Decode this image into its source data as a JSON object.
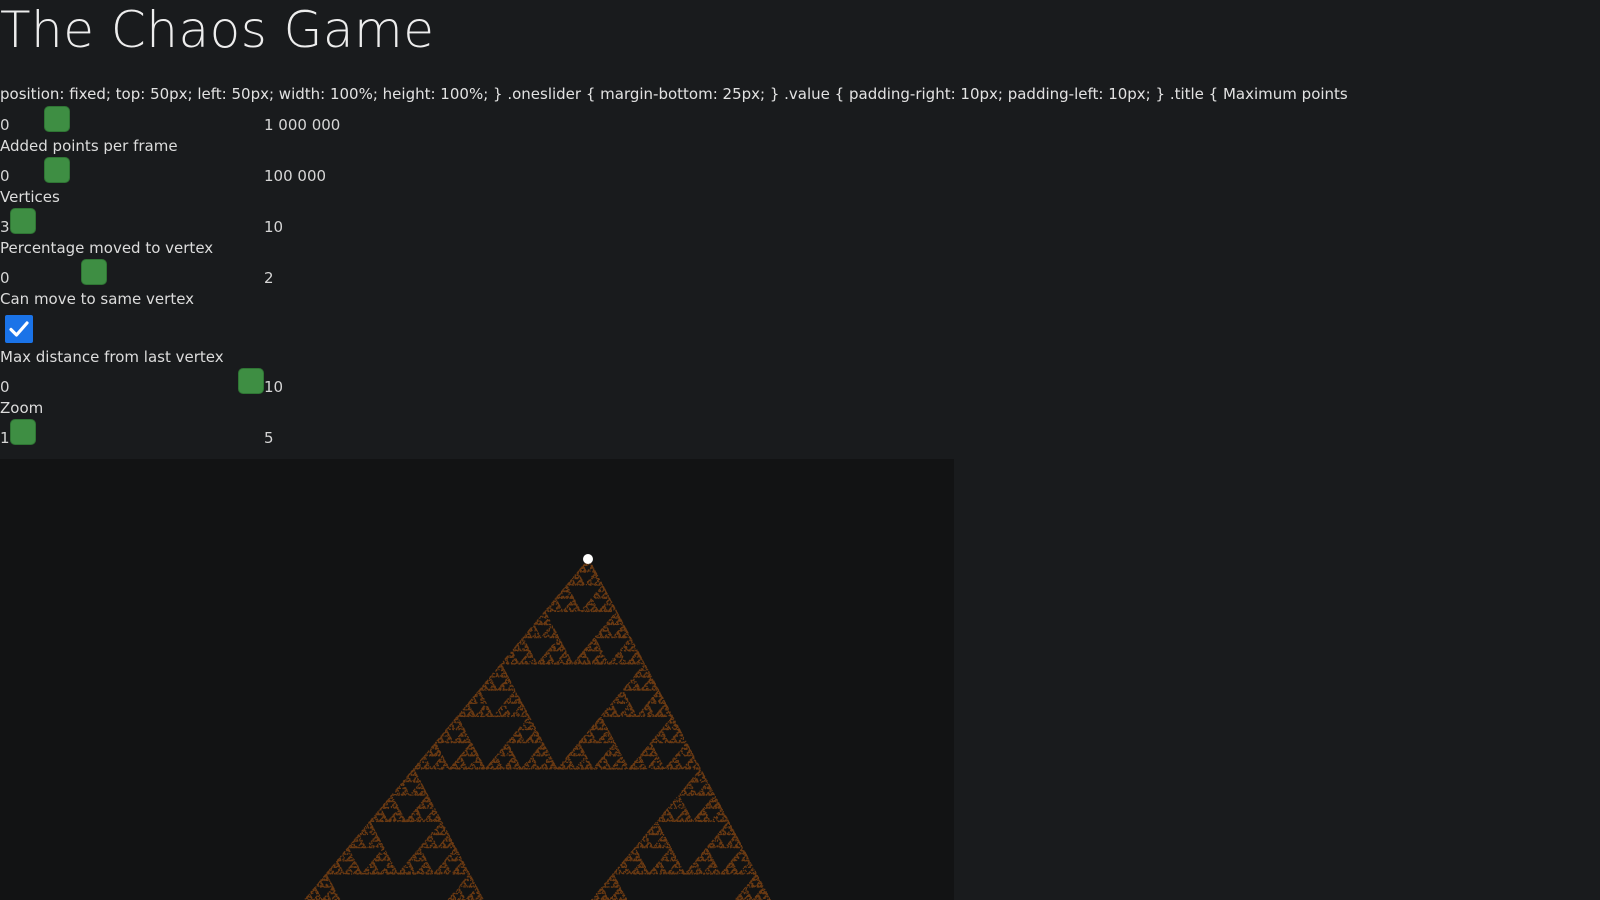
{
  "page": {
    "title": "The Chaos Game",
    "leaked_css_text": "position: fixed; top: 50px; left: 50px; width: 100%; height: 100%; } .oneslider { margin-bottom: 25px; } .value { padding-right: 10px; padding-left: 10px; } .title { Maximum points"
  },
  "controls": {
    "max_points": {
      "min": "0",
      "max": "1 000 000",
      "fraction": 0.15
    },
    "points_per_frame": {
      "label": "Added points per frame",
      "min": "0",
      "max": "100 000",
      "fraction": 0.15
    },
    "vertices": {
      "label": "Vertices",
      "min": "3",
      "max": "10",
      "fraction": 0.0
    },
    "percentage": {
      "label": "Percentage moved to vertex",
      "min": "0",
      "max": "2",
      "fraction": 0.31
    },
    "same_vertex": {
      "label": "Can move to same vertex",
      "checked": true
    },
    "max_distance": {
      "label": "Max distance from last vertex",
      "min": "0",
      "max": "10",
      "fraction": 1.0
    },
    "zoom": {
      "label": "Zoom",
      "min": "1",
      "max": "5",
      "fraction": 0.0
    }
  },
  "colors": {
    "background": "#191b1d",
    "canvas": "#121314",
    "slider_thumb": "#3e8e43",
    "checkbox": "#1a73e8",
    "fractal": "#6b3a12",
    "vertex_marker": "#ffffff"
  }
}
